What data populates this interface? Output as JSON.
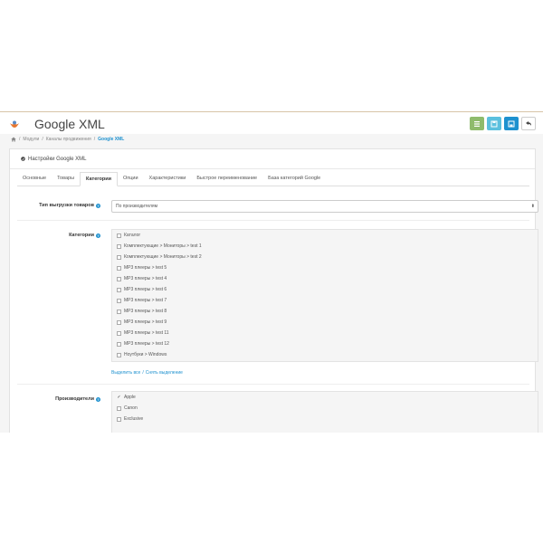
{
  "header": {
    "title": "Google XML",
    "actions": [
      "filter-icon",
      "save-icon",
      "save-stay-icon",
      "back-icon"
    ]
  },
  "breadcrumb": {
    "items": [
      "Модули",
      "Каналы продвижения",
      "Google XML"
    ]
  },
  "panel": {
    "title": "Настройки Google XML",
    "tabs": [
      "Основные",
      "Товары",
      "Категории",
      "Опции",
      "Характеристики",
      "Быстрое переименование",
      "База категорий Google"
    ],
    "active_tab": "Категории"
  },
  "export_type": {
    "label": "Тип выгрузки товаров",
    "value": "По производителям"
  },
  "categories": {
    "label": "Категории",
    "items": [
      {
        "name": "Каталог",
        "checked": false
      },
      {
        "name": "Комплектующие  >  Мониторы  >  test 1",
        "checked": false
      },
      {
        "name": "Комплектующие  >  Мониторы  >  test 2",
        "checked": false
      },
      {
        "name": "MP3 плееры  >  test 5",
        "checked": false
      },
      {
        "name": "MP3 плееры  >  test 4",
        "checked": false
      },
      {
        "name": "MP3 плееры  >  test 6",
        "checked": false
      },
      {
        "name": "MP3 плееры  >  test 7",
        "checked": false
      },
      {
        "name": "MP3 плееры  >  test 8",
        "checked": false
      },
      {
        "name": "MP3 плееры  >  test 9",
        "checked": false
      },
      {
        "name": "MP3 плееры  >  test 11",
        "checked": false
      },
      {
        "name": "MP3 плееры  >  test 12",
        "checked": false
      },
      {
        "name": "Ноутбуки  >  Windows",
        "checked": false
      }
    ],
    "select_all": "Выделить все",
    "separator": "/",
    "deselect_all": "Снять выделение"
  },
  "manufacturers": {
    "label": "Производители",
    "items": [
      {
        "name": "Apple",
        "checked": true
      },
      {
        "name": "Canon",
        "checked": false
      },
      {
        "name": "Exclusive",
        "checked": false
      }
    ]
  },
  "colors": {
    "accent": "#1e91cf",
    "green": "#8fbb6c",
    "cyan": "#5bc0de"
  }
}
